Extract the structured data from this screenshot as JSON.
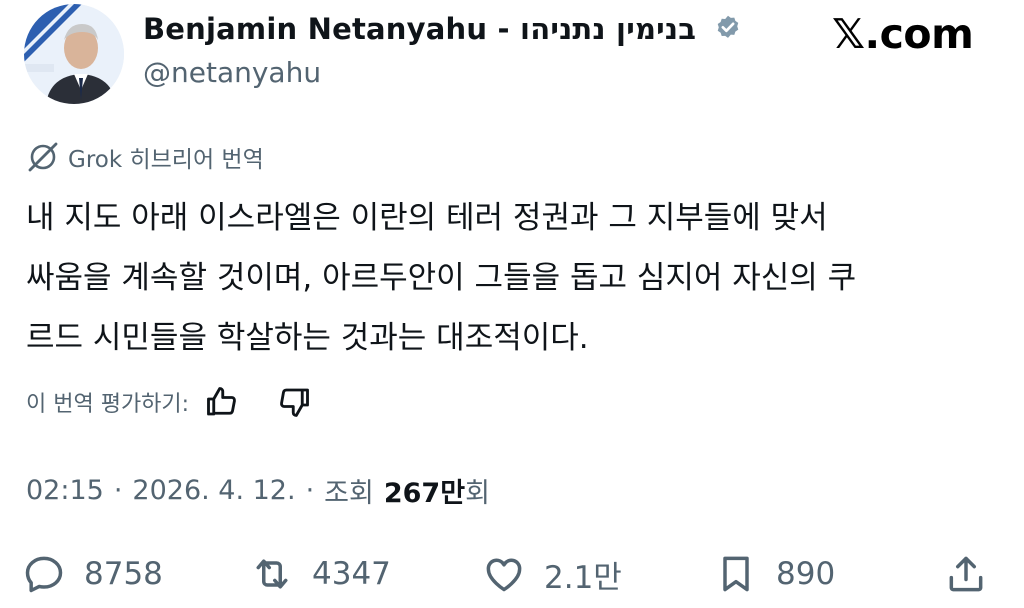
{
  "header": {
    "display_name": "Benjamin Netanyahu - בנימין נתניהו",
    "handle": "@netanyahu",
    "site_brand": "𝕏.com"
  },
  "translation": {
    "label": "Grok 히브리어 번역"
  },
  "tweet": {
    "lines": [
      "내 지도 아래 이스라엘은 이란의 테러 정권과 그 지부들에 맞서",
      "싸움을 계속할 것이며, 아르두안이 그들을 돕고 심지어 자신의 쿠",
      "르드 시민들을 학살하는 것과는 대조적이다."
    ]
  },
  "rate": {
    "label": "이 번역 평가하기:"
  },
  "meta": {
    "time": "02:15",
    "date": "2026. 4. 12.",
    "views_label": "조회",
    "views_count": "267만",
    "views_unit": "회"
  },
  "actions": {
    "replies": "8758",
    "reposts": "4347",
    "likes": "2.1만",
    "bookmarks": "890"
  },
  "colors": {
    "text_primary": "#0f1419",
    "text_secondary": "#536471",
    "badge": "#829aab"
  },
  "icons": [
    "grok-icon",
    "verified-badge-icon",
    "thumbs-up-icon",
    "thumbs-down-icon",
    "reply-icon",
    "repost-icon",
    "like-icon",
    "bookmark-icon",
    "share-icon"
  ]
}
